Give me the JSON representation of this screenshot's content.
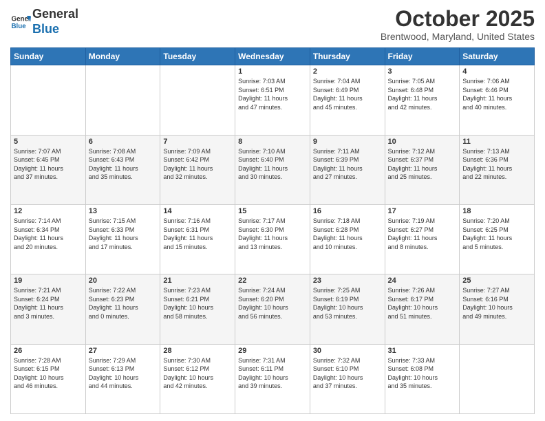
{
  "header": {
    "logo_general": "General",
    "logo_blue": "Blue",
    "month_title": "October 2025",
    "location": "Brentwood, Maryland, United States"
  },
  "days_of_week": [
    "Sunday",
    "Monday",
    "Tuesday",
    "Wednesday",
    "Thursday",
    "Friday",
    "Saturday"
  ],
  "weeks": [
    {
      "cells": [
        {
          "day": "",
          "info": ""
        },
        {
          "day": "",
          "info": ""
        },
        {
          "day": "",
          "info": ""
        },
        {
          "day": "1",
          "info": "Sunrise: 7:03 AM\nSunset: 6:51 PM\nDaylight: 11 hours\nand 47 minutes."
        },
        {
          "day": "2",
          "info": "Sunrise: 7:04 AM\nSunset: 6:49 PM\nDaylight: 11 hours\nand 45 minutes."
        },
        {
          "day": "3",
          "info": "Sunrise: 7:05 AM\nSunset: 6:48 PM\nDaylight: 11 hours\nand 42 minutes."
        },
        {
          "day": "4",
          "info": "Sunrise: 7:06 AM\nSunset: 6:46 PM\nDaylight: 11 hours\nand 40 minutes."
        }
      ]
    },
    {
      "cells": [
        {
          "day": "5",
          "info": "Sunrise: 7:07 AM\nSunset: 6:45 PM\nDaylight: 11 hours\nand 37 minutes."
        },
        {
          "day": "6",
          "info": "Sunrise: 7:08 AM\nSunset: 6:43 PM\nDaylight: 11 hours\nand 35 minutes."
        },
        {
          "day": "7",
          "info": "Sunrise: 7:09 AM\nSunset: 6:42 PM\nDaylight: 11 hours\nand 32 minutes."
        },
        {
          "day": "8",
          "info": "Sunrise: 7:10 AM\nSunset: 6:40 PM\nDaylight: 11 hours\nand 30 minutes."
        },
        {
          "day": "9",
          "info": "Sunrise: 7:11 AM\nSunset: 6:39 PM\nDaylight: 11 hours\nand 27 minutes."
        },
        {
          "day": "10",
          "info": "Sunrise: 7:12 AM\nSunset: 6:37 PM\nDaylight: 11 hours\nand 25 minutes."
        },
        {
          "day": "11",
          "info": "Sunrise: 7:13 AM\nSunset: 6:36 PM\nDaylight: 11 hours\nand 22 minutes."
        }
      ]
    },
    {
      "cells": [
        {
          "day": "12",
          "info": "Sunrise: 7:14 AM\nSunset: 6:34 PM\nDaylight: 11 hours\nand 20 minutes."
        },
        {
          "day": "13",
          "info": "Sunrise: 7:15 AM\nSunset: 6:33 PM\nDaylight: 11 hours\nand 17 minutes."
        },
        {
          "day": "14",
          "info": "Sunrise: 7:16 AM\nSunset: 6:31 PM\nDaylight: 11 hours\nand 15 minutes."
        },
        {
          "day": "15",
          "info": "Sunrise: 7:17 AM\nSunset: 6:30 PM\nDaylight: 11 hours\nand 13 minutes."
        },
        {
          "day": "16",
          "info": "Sunrise: 7:18 AM\nSunset: 6:28 PM\nDaylight: 11 hours\nand 10 minutes."
        },
        {
          "day": "17",
          "info": "Sunrise: 7:19 AM\nSunset: 6:27 PM\nDaylight: 11 hours\nand 8 minutes."
        },
        {
          "day": "18",
          "info": "Sunrise: 7:20 AM\nSunset: 6:25 PM\nDaylight: 11 hours\nand 5 minutes."
        }
      ]
    },
    {
      "cells": [
        {
          "day": "19",
          "info": "Sunrise: 7:21 AM\nSunset: 6:24 PM\nDaylight: 11 hours\nand 3 minutes."
        },
        {
          "day": "20",
          "info": "Sunrise: 7:22 AM\nSunset: 6:23 PM\nDaylight: 11 hours\nand 0 minutes."
        },
        {
          "day": "21",
          "info": "Sunrise: 7:23 AM\nSunset: 6:21 PM\nDaylight: 10 hours\nand 58 minutes."
        },
        {
          "day": "22",
          "info": "Sunrise: 7:24 AM\nSunset: 6:20 PM\nDaylight: 10 hours\nand 56 minutes."
        },
        {
          "day": "23",
          "info": "Sunrise: 7:25 AM\nSunset: 6:19 PM\nDaylight: 10 hours\nand 53 minutes."
        },
        {
          "day": "24",
          "info": "Sunrise: 7:26 AM\nSunset: 6:17 PM\nDaylight: 10 hours\nand 51 minutes."
        },
        {
          "day": "25",
          "info": "Sunrise: 7:27 AM\nSunset: 6:16 PM\nDaylight: 10 hours\nand 49 minutes."
        }
      ]
    },
    {
      "cells": [
        {
          "day": "26",
          "info": "Sunrise: 7:28 AM\nSunset: 6:15 PM\nDaylight: 10 hours\nand 46 minutes."
        },
        {
          "day": "27",
          "info": "Sunrise: 7:29 AM\nSunset: 6:13 PM\nDaylight: 10 hours\nand 44 minutes."
        },
        {
          "day": "28",
          "info": "Sunrise: 7:30 AM\nSunset: 6:12 PM\nDaylight: 10 hours\nand 42 minutes."
        },
        {
          "day": "29",
          "info": "Sunrise: 7:31 AM\nSunset: 6:11 PM\nDaylight: 10 hours\nand 39 minutes."
        },
        {
          "day": "30",
          "info": "Sunrise: 7:32 AM\nSunset: 6:10 PM\nDaylight: 10 hours\nand 37 minutes."
        },
        {
          "day": "31",
          "info": "Sunrise: 7:33 AM\nSunset: 6:08 PM\nDaylight: 10 hours\nand 35 minutes."
        },
        {
          "day": "",
          "info": ""
        }
      ]
    }
  ]
}
